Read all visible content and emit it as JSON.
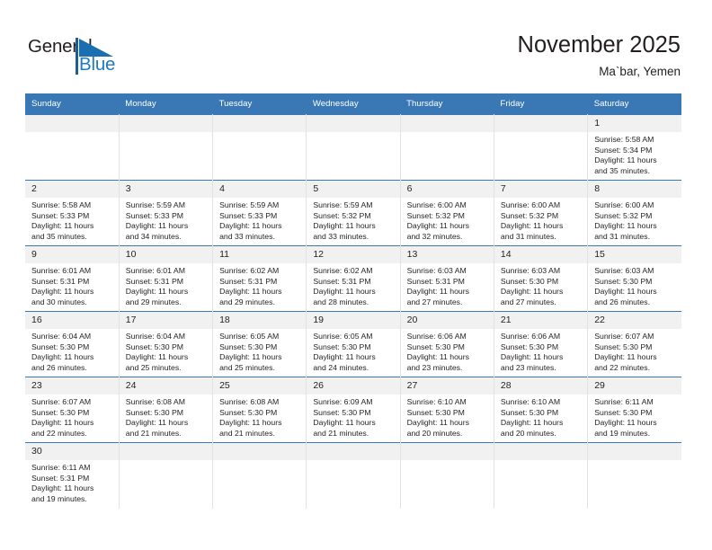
{
  "brand": {
    "name_part1": "General",
    "name_part2": "Blue",
    "logo_icon": "blue-flag-triangle"
  },
  "header": {
    "title": "November 2025",
    "subtitle": "Ma`bar, Yemen"
  },
  "colors": {
    "header_blue": "#3a78b5",
    "brand_blue": "#1f7bc1",
    "daynum_band": "#f1f1f1",
    "text": "#231f20",
    "cell_border": "#e2e2e2"
  },
  "weekday_headers": [
    "Sunday",
    "Monday",
    "Tuesday",
    "Wednesday",
    "Thursday",
    "Friday",
    "Saturday"
  ],
  "weeks": [
    [
      {
        "day": "",
        "blank": true
      },
      {
        "day": "",
        "blank": true
      },
      {
        "day": "",
        "blank": true
      },
      {
        "day": "",
        "blank": true
      },
      {
        "day": "",
        "blank": true
      },
      {
        "day": "",
        "blank": true
      },
      {
        "day": "1",
        "sunrise": "Sunrise: 5:58 AM",
        "sunset": "Sunset: 5:34 PM",
        "daylight1": "Daylight: 11 hours",
        "daylight2": "and 35 minutes."
      }
    ],
    [
      {
        "day": "2",
        "sunrise": "Sunrise: 5:58 AM",
        "sunset": "Sunset: 5:33 PM",
        "daylight1": "Daylight: 11 hours",
        "daylight2": "and 35 minutes."
      },
      {
        "day": "3",
        "sunrise": "Sunrise: 5:59 AM",
        "sunset": "Sunset: 5:33 PM",
        "daylight1": "Daylight: 11 hours",
        "daylight2": "and 34 minutes."
      },
      {
        "day": "4",
        "sunrise": "Sunrise: 5:59 AM",
        "sunset": "Sunset: 5:33 PM",
        "daylight1": "Daylight: 11 hours",
        "daylight2": "and 33 minutes."
      },
      {
        "day": "5",
        "sunrise": "Sunrise: 5:59 AM",
        "sunset": "Sunset: 5:32 PM",
        "daylight1": "Daylight: 11 hours",
        "daylight2": "and 33 minutes."
      },
      {
        "day": "6",
        "sunrise": "Sunrise: 6:00 AM",
        "sunset": "Sunset: 5:32 PM",
        "daylight1": "Daylight: 11 hours",
        "daylight2": "and 32 minutes."
      },
      {
        "day": "7",
        "sunrise": "Sunrise: 6:00 AM",
        "sunset": "Sunset: 5:32 PM",
        "daylight1": "Daylight: 11 hours",
        "daylight2": "and 31 minutes."
      },
      {
        "day": "8",
        "sunrise": "Sunrise: 6:00 AM",
        "sunset": "Sunset: 5:32 PM",
        "daylight1": "Daylight: 11 hours",
        "daylight2": "and 31 minutes."
      }
    ],
    [
      {
        "day": "9",
        "sunrise": "Sunrise: 6:01 AM",
        "sunset": "Sunset: 5:31 PM",
        "daylight1": "Daylight: 11 hours",
        "daylight2": "and 30 minutes."
      },
      {
        "day": "10",
        "sunrise": "Sunrise: 6:01 AM",
        "sunset": "Sunset: 5:31 PM",
        "daylight1": "Daylight: 11 hours",
        "daylight2": "and 29 minutes."
      },
      {
        "day": "11",
        "sunrise": "Sunrise: 6:02 AM",
        "sunset": "Sunset: 5:31 PM",
        "daylight1": "Daylight: 11 hours",
        "daylight2": "and 29 minutes."
      },
      {
        "day": "12",
        "sunrise": "Sunrise: 6:02 AM",
        "sunset": "Sunset: 5:31 PM",
        "daylight1": "Daylight: 11 hours",
        "daylight2": "and 28 minutes."
      },
      {
        "day": "13",
        "sunrise": "Sunrise: 6:03 AM",
        "sunset": "Sunset: 5:31 PM",
        "daylight1": "Daylight: 11 hours",
        "daylight2": "and 27 minutes."
      },
      {
        "day": "14",
        "sunrise": "Sunrise: 6:03 AM",
        "sunset": "Sunset: 5:30 PM",
        "daylight1": "Daylight: 11 hours",
        "daylight2": "and 27 minutes."
      },
      {
        "day": "15",
        "sunrise": "Sunrise: 6:03 AM",
        "sunset": "Sunset: 5:30 PM",
        "daylight1": "Daylight: 11 hours",
        "daylight2": "and 26 minutes."
      }
    ],
    [
      {
        "day": "16",
        "sunrise": "Sunrise: 6:04 AM",
        "sunset": "Sunset: 5:30 PM",
        "daylight1": "Daylight: 11 hours",
        "daylight2": "and 26 minutes."
      },
      {
        "day": "17",
        "sunrise": "Sunrise: 6:04 AM",
        "sunset": "Sunset: 5:30 PM",
        "daylight1": "Daylight: 11 hours",
        "daylight2": "and 25 minutes."
      },
      {
        "day": "18",
        "sunrise": "Sunrise: 6:05 AM",
        "sunset": "Sunset: 5:30 PM",
        "daylight1": "Daylight: 11 hours",
        "daylight2": "and 25 minutes."
      },
      {
        "day": "19",
        "sunrise": "Sunrise: 6:05 AM",
        "sunset": "Sunset: 5:30 PM",
        "daylight1": "Daylight: 11 hours",
        "daylight2": "and 24 minutes."
      },
      {
        "day": "20",
        "sunrise": "Sunrise: 6:06 AM",
        "sunset": "Sunset: 5:30 PM",
        "daylight1": "Daylight: 11 hours",
        "daylight2": "and 23 minutes."
      },
      {
        "day": "21",
        "sunrise": "Sunrise: 6:06 AM",
        "sunset": "Sunset: 5:30 PM",
        "daylight1": "Daylight: 11 hours",
        "daylight2": "and 23 minutes."
      },
      {
        "day": "22",
        "sunrise": "Sunrise: 6:07 AM",
        "sunset": "Sunset: 5:30 PM",
        "daylight1": "Daylight: 11 hours",
        "daylight2": "and 22 minutes."
      }
    ],
    [
      {
        "day": "23",
        "sunrise": "Sunrise: 6:07 AM",
        "sunset": "Sunset: 5:30 PM",
        "daylight1": "Daylight: 11 hours",
        "daylight2": "and 22 minutes."
      },
      {
        "day": "24",
        "sunrise": "Sunrise: 6:08 AM",
        "sunset": "Sunset: 5:30 PM",
        "daylight1": "Daylight: 11 hours",
        "daylight2": "and 21 minutes."
      },
      {
        "day": "25",
        "sunrise": "Sunrise: 6:08 AM",
        "sunset": "Sunset: 5:30 PM",
        "daylight1": "Daylight: 11 hours",
        "daylight2": "and 21 minutes."
      },
      {
        "day": "26",
        "sunrise": "Sunrise: 6:09 AM",
        "sunset": "Sunset: 5:30 PM",
        "daylight1": "Daylight: 11 hours",
        "daylight2": "and 21 minutes."
      },
      {
        "day": "27",
        "sunrise": "Sunrise: 6:10 AM",
        "sunset": "Sunset: 5:30 PM",
        "daylight1": "Daylight: 11 hours",
        "daylight2": "and 20 minutes."
      },
      {
        "day": "28",
        "sunrise": "Sunrise: 6:10 AM",
        "sunset": "Sunset: 5:30 PM",
        "daylight1": "Daylight: 11 hours",
        "daylight2": "and 20 minutes."
      },
      {
        "day": "29",
        "sunrise": "Sunrise: 6:11 AM",
        "sunset": "Sunset: 5:30 PM",
        "daylight1": "Daylight: 11 hours",
        "daylight2": "and 19 minutes."
      }
    ],
    [
      {
        "day": "30",
        "sunrise": "Sunrise: 6:11 AM",
        "sunset": "Sunset: 5:31 PM",
        "daylight1": "Daylight: 11 hours",
        "daylight2": "and 19 minutes."
      },
      {
        "day": "",
        "blank": true
      },
      {
        "day": "",
        "blank": true
      },
      {
        "day": "",
        "blank": true
      },
      {
        "day": "",
        "blank": true
      },
      {
        "day": "",
        "blank": true
      },
      {
        "day": "",
        "blank": true
      }
    ]
  ]
}
